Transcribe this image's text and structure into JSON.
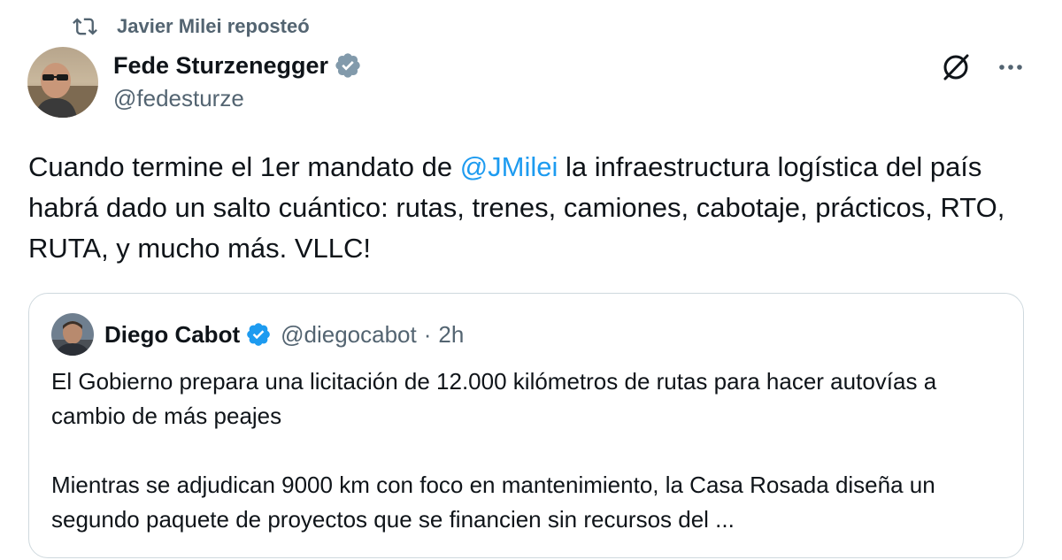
{
  "repost": {
    "label": "Javier Milei reposteó",
    "icon": "repost-icon"
  },
  "author": {
    "name": "Fede Sturzenegger",
    "handle": "@fedesturze",
    "verified": true,
    "verified_color": "#829aab"
  },
  "tweet": {
    "text_before": "Cuando termine el 1er mandato de ",
    "mention": "@JMilei",
    "text_after": " la infraestructura logística del país habrá dado un salto cuántico: rutas, trenes, camiones, cabotaje, prácticos, RTO, RUTA, y mucho más. VLLC!"
  },
  "quote": {
    "name": "Diego Cabot",
    "handle": "@diegocabot",
    "separator": "·",
    "time": "2h",
    "verified": true,
    "verified_color": "#1d9bf0",
    "paragraph1": "El Gobierno prepara una licitación de 12.000 kilómetros de rutas para hacer autovías a cambio de más peajes",
    "paragraph2": "Mientras se adjudican 9000 km con foco en mantenimiento, la Casa Rosada diseña un segundo paquete de proyectos que se financien sin recursos del ..."
  },
  "actions": {
    "grok_icon": "grok-icon",
    "more_icon": "more-options-icon"
  },
  "colors": {
    "text": "#0f1419",
    "secondary": "#536471",
    "link": "#1d9bf0",
    "border": "#cfd9de"
  }
}
